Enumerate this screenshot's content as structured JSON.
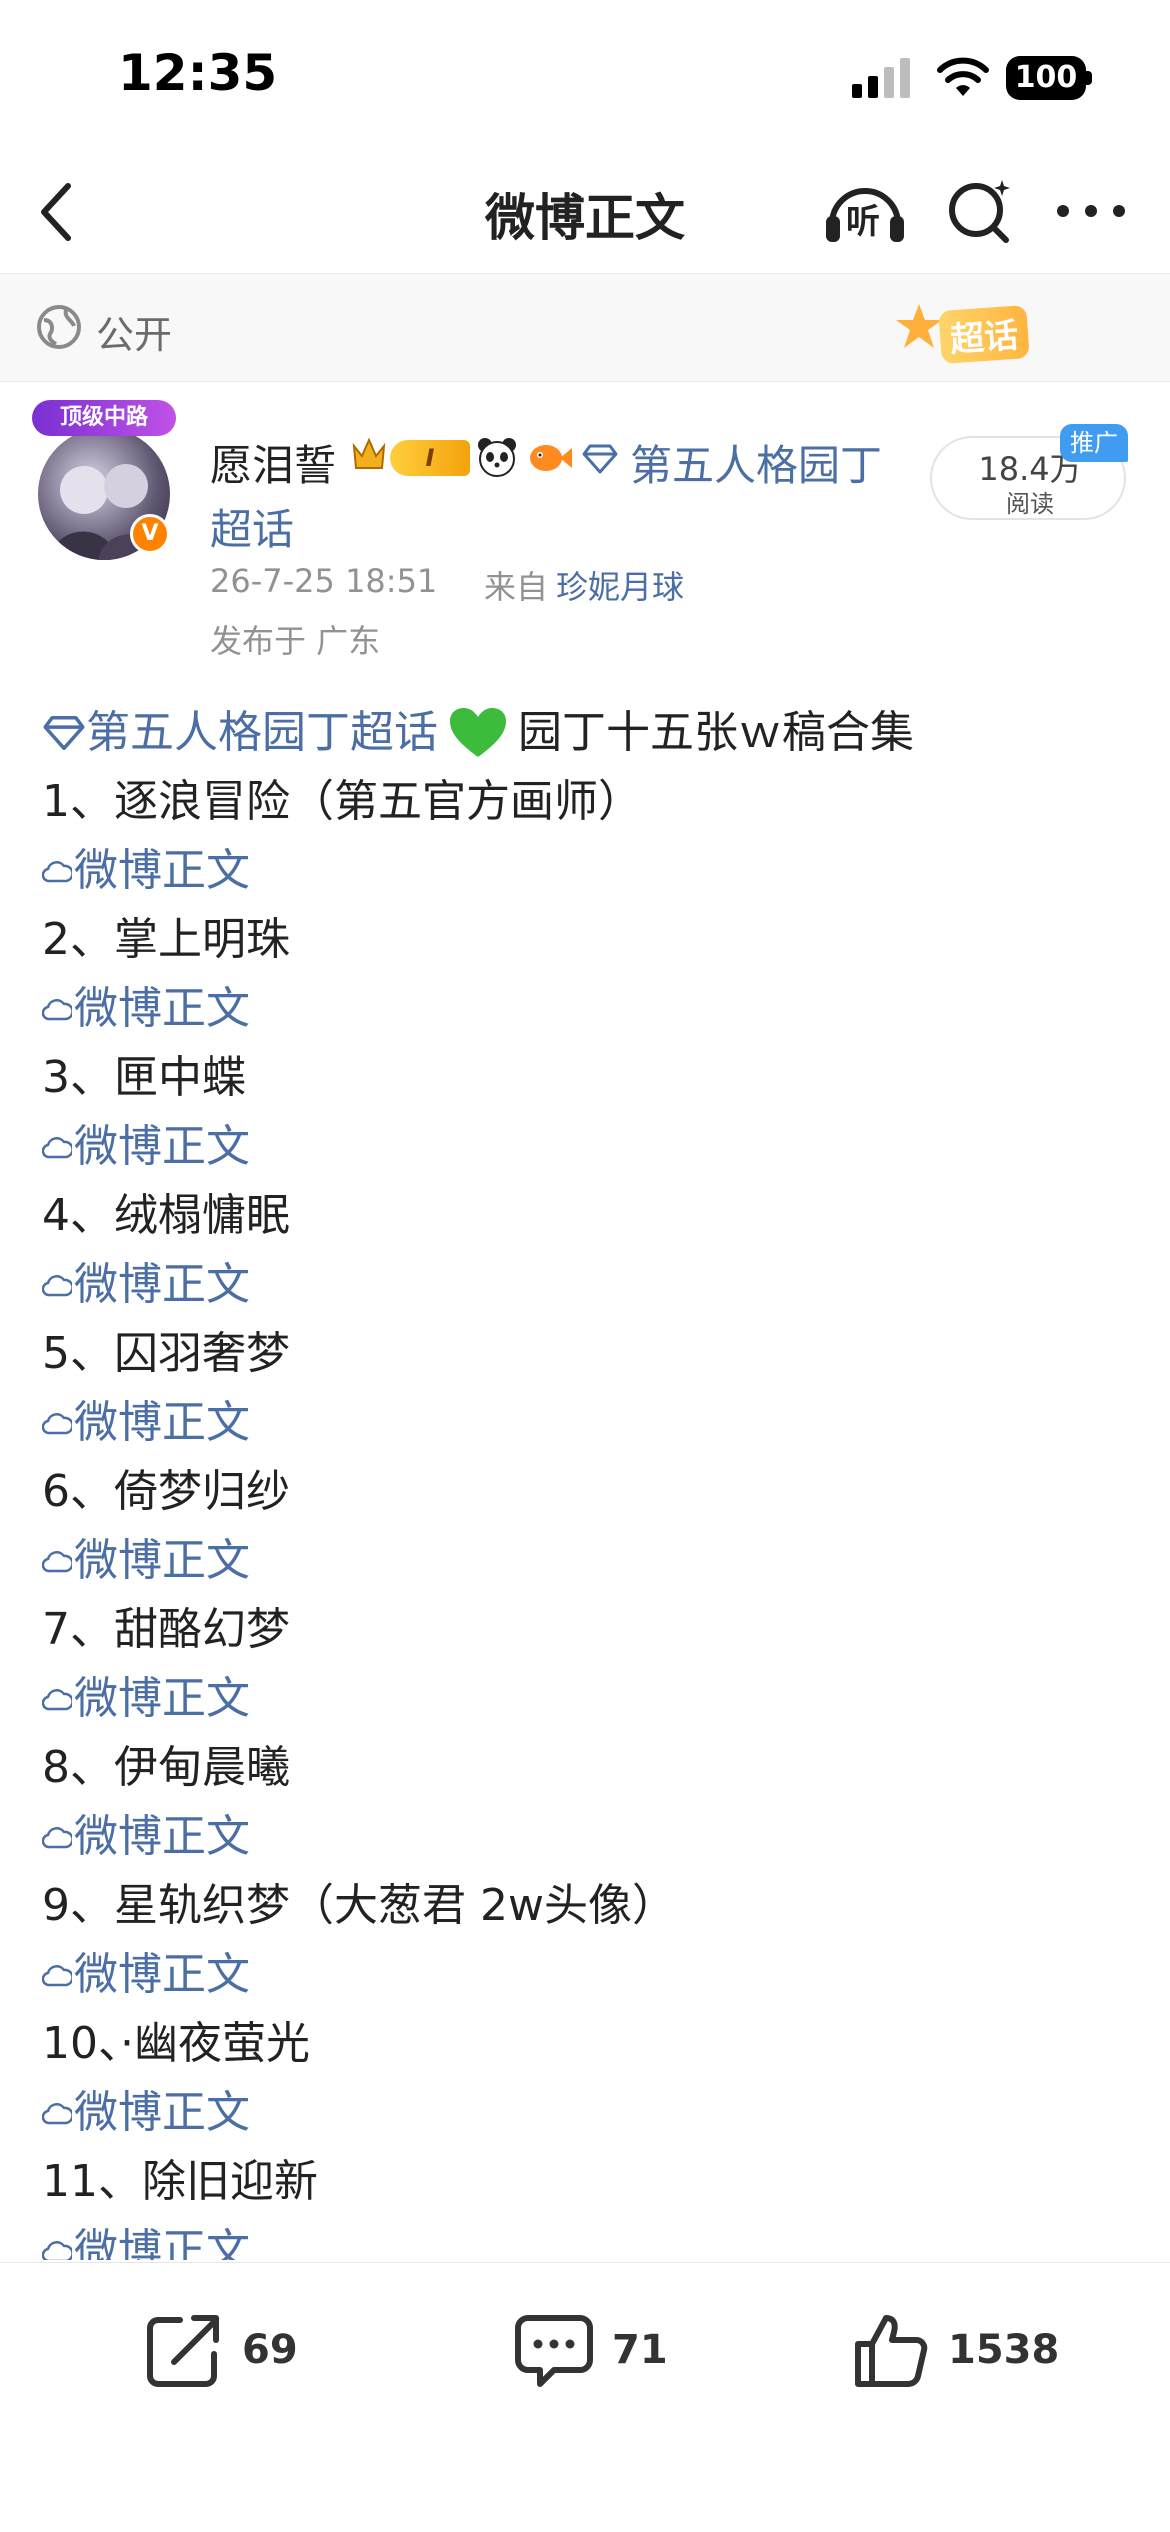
{
  "status_bar": {
    "time": "12:35",
    "battery": "100"
  },
  "nav": {
    "title": "微博正文",
    "listen_label": "听"
  },
  "visibility": {
    "label": "公开",
    "supertopic_badge": "超话"
  },
  "author": {
    "avatar_frame_label": "顶级中路",
    "verified_mark": "V",
    "name": "愿泪誓",
    "level_badge": "I",
    "topic_link_part1": "第五人格园丁",
    "topic_link_part2": "超话",
    "time": "26-7-25 18:51",
    "source_prefix": "来自",
    "source": "珍妮月球",
    "location": "发布于 广东",
    "read_count": "18.4万",
    "read_label": "阅读",
    "promo_badge": "推广"
  },
  "post": {
    "intro_topic": "第五人格园丁超话",
    "intro_text": "园丁十五张ｗ稿合集",
    "link_label": "微博正文",
    "items": [
      "1、逐浪冒险（第五官方画师）",
      "2、掌上明珠",
      "3、匣中蝶",
      "4、绒榻慵眠",
      "5、囚羽奢梦",
      "6、倚梦归纱",
      "7、甜酪幻梦",
      "8、伊甸晨曦",
      "9、星轨织梦（大葱君 2w头像）",
      "10、·幽夜萤光",
      "11、除旧迎新"
    ]
  },
  "actions": {
    "share_count": "69",
    "comment_count": "71",
    "like_count": "1538"
  },
  "colors": {
    "link": "#4b6ea5",
    "accent_orange": "#ff8200",
    "promo_blue": "#3f9cf0"
  }
}
